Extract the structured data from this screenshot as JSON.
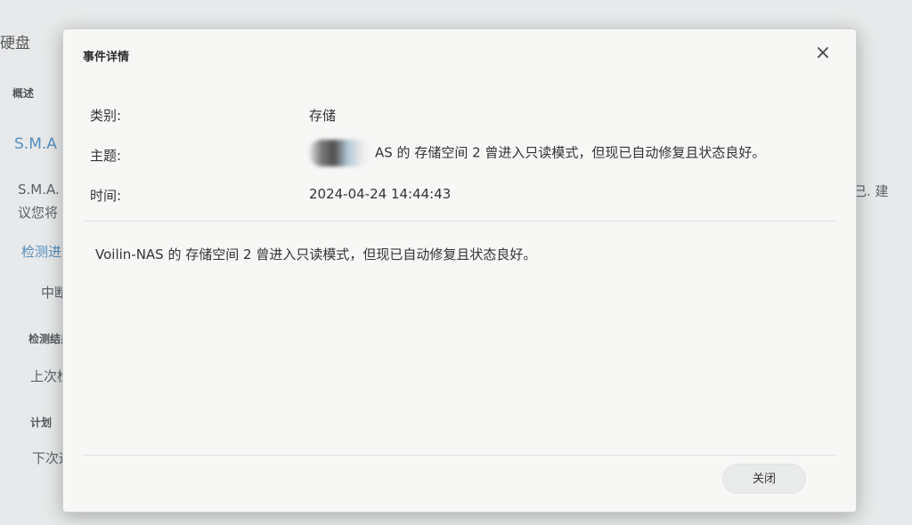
{
  "background": {
    "title": "硬盘",
    "tab_overview": "概述",
    "smart_title": "S.M.A",
    "smart_desc_1": "S.M.A.",
    "smart_desc_2": "议您将",
    "smart_desc_right": "己. 建",
    "test_progress_link": "检测进",
    "interrupted": "中断",
    "test_result_heading": "检测结果",
    "last_test": "上次检",
    "schedule_heading": "计划",
    "next_run": "下次运"
  },
  "dialog": {
    "title": "事件详情",
    "close_icon": "×",
    "category_label": "类别:",
    "category_value": "存储",
    "subject_label": "主题:",
    "subject_value": "AS 的 存储空间 2 曾进入只读模式，但现已自动修复且状态良好。",
    "time_label": "时间:",
    "time_value": "2024-04-24 14:44:43",
    "message": "Voilin-NAS 的 存储空间 2 曾进入只读模式，但现已自动修复且状态良好。",
    "close_button": "关闭"
  }
}
